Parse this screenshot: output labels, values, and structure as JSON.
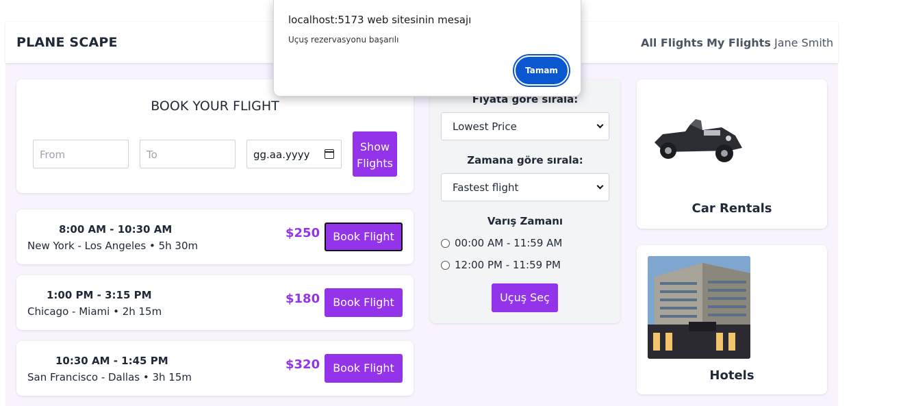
{
  "navbar": {
    "brand": "PLANE SCAPE",
    "links": [
      "All Flights",
      "My Flights"
    ],
    "user": "Jane Smith"
  },
  "booking": {
    "title": "BOOK YOUR FLIGHT",
    "from_placeholder": "From",
    "to_placeholder": "To",
    "date_value": "gg.aa.yyyy",
    "show_button": "Show Flights"
  },
  "flights": [
    {
      "time": "8:00 AM - 10:30 AM",
      "route": "New York - Los Angeles • 5h 30m",
      "price": "$250",
      "button": "Book Flight"
    },
    {
      "time": "1:00 PM - 3:15 PM",
      "route": "Chicago - Miami • 2h 15m",
      "price": "$180",
      "button": "Book Flight"
    },
    {
      "time": "10:30 AM - 1:45 PM",
      "route": "San Francisco - Dallas • 3h 15m",
      "price": "$320",
      "button": "Book Flight"
    }
  ],
  "filters": {
    "price_label": "Fiyata göre sırala:",
    "price_selected": "Lowest Price",
    "time_label": "Zamana göre sırala:",
    "time_selected": "Fastest flight",
    "arrival_label": "Varış Zamanı",
    "arrival_options": [
      "00:00 AM - 11:59 AM",
      "12:00 PM - 11:59 PM"
    ],
    "select_button": "Uçuş Seç"
  },
  "side": {
    "car_title": "Car Rentals",
    "hotel_title": "Hotels"
  },
  "dialog": {
    "title": "localhost:5173 web sitesinin mesajı",
    "message": "Uçuş rezervasyonu başarılı",
    "ok_button": "Tamam"
  },
  "colors": {
    "accent": "#9333ea",
    "dialog_button": "#0b57d0",
    "page_bg": "#f8f3fd"
  }
}
